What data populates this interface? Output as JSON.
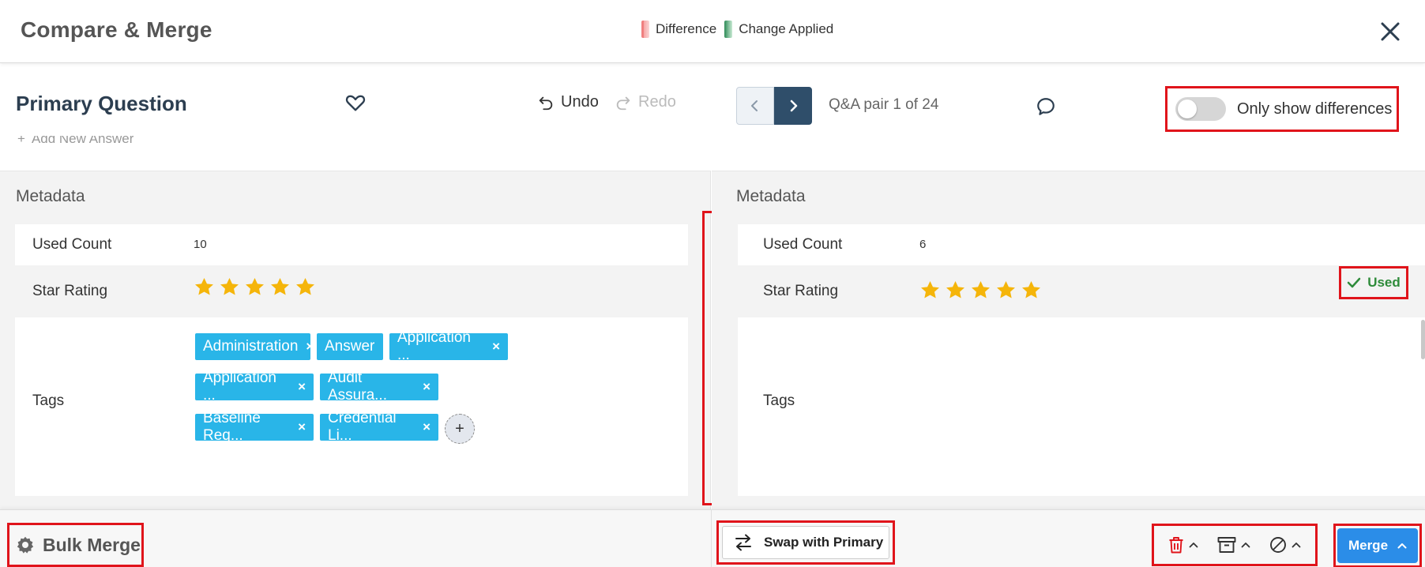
{
  "header": {
    "title": "Compare & Merge",
    "legend": {
      "difference": "Difference",
      "change_applied": "Change Applied"
    }
  },
  "left": {
    "title": "Primary Question",
    "undo": "Undo",
    "redo": "Redo",
    "add_answer": "Add New Answer",
    "metadata_title": "Metadata",
    "used_count_label": "Used Count",
    "used_count_value": "10",
    "star_rating_label": "Star Rating",
    "star_rating": 5,
    "tags_label": "Tags",
    "tags": [
      "Administration",
      "Answer",
      "Application ...",
      "Application ...",
      "Audit Assura...",
      "Baseline Req...",
      "Credential Li..."
    ],
    "tag_add": "+"
  },
  "right": {
    "pager_text": "Q&A pair 1 of 24",
    "only_diff_label": "Only show differences",
    "only_diff_on": false,
    "metadata_title": "Metadata",
    "used_count_label": "Used Count",
    "used_count_value": "6",
    "star_rating_label": "Star Rating",
    "star_rating": 5,
    "used_badge": "Used",
    "tags_label": "Tags"
  },
  "footer": {
    "bulk_merge": "Bulk Merge",
    "swap": "Swap with Primary",
    "merge": "Merge"
  },
  "colors": {
    "accent": "#2b8de8",
    "tag": "#29b5e8",
    "difference": "#f6a5a5",
    "applied": "#2e8b57",
    "highlight": "#e0141b",
    "star": "#f5b50a"
  }
}
